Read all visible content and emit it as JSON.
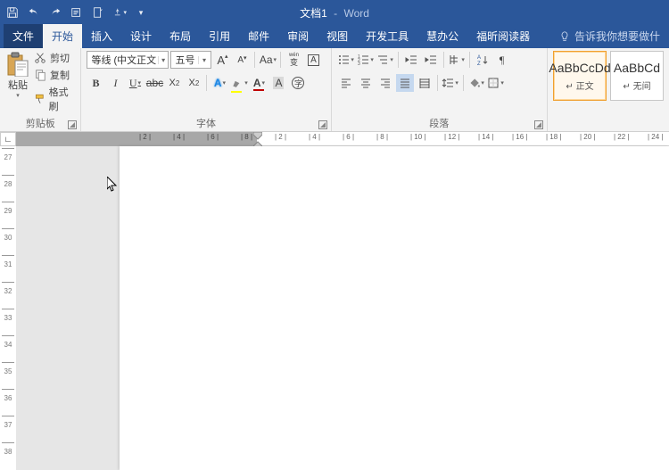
{
  "title": {
    "doc": "文档1",
    "sep": "-",
    "app": "Word"
  },
  "tabs": {
    "file": "文件",
    "home": "开始",
    "insert": "插入",
    "design": "设计",
    "layout": "布局",
    "references": "引用",
    "mail": "邮件",
    "review": "审阅",
    "view": "视图",
    "dev": "开发工具",
    "huiban": "慧办公",
    "foxit": "福昕阅读器"
  },
  "tellme": "告诉我你想要做什",
  "clipboard": {
    "paste": "粘贴",
    "cut": "剪切",
    "copy": "复制",
    "painter": "格式刷",
    "group": "剪贴板"
  },
  "font": {
    "family": "等线 (中文正文",
    "size": "五号",
    "group": "字体"
  },
  "paragraph": {
    "group": "段落"
  },
  "styles": {
    "sample": "AaBbCcDd",
    "sample2": "AaBbCd",
    "normal": "正文",
    "nospacing": "无间"
  },
  "hruler": {
    "dark_ticks": [
      "8",
      "6",
      "4",
      "2"
    ],
    "light_ticks": [
      "2",
      "4",
      "6",
      "8",
      "10",
      "12",
      "14",
      "16",
      "18",
      "20",
      "22",
      "24"
    ]
  },
  "vruler": {
    "ticks": [
      "27",
      "28",
      "29",
      "30",
      "31",
      "32",
      "33",
      "34",
      "35",
      "36",
      "37",
      "38"
    ]
  },
  "colors": {
    "brand": "#2b579a",
    "ribbon": "#f3f3f3",
    "highlight": "#ffff00",
    "fontcolor": "#c00000",
    "shading": "#d9d9d9"
  }
}
